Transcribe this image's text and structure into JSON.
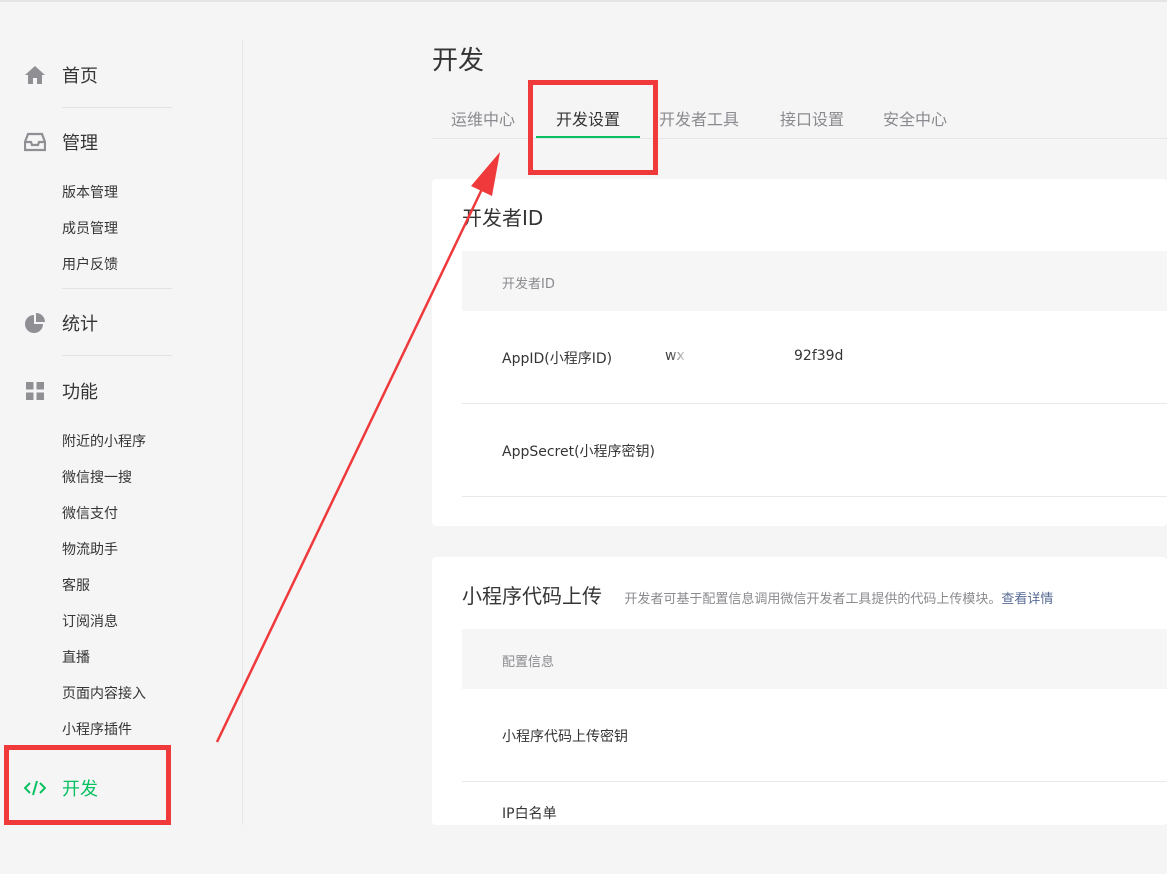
{
  "sidebar": {
    "home": {
      "label": "首页",
      "icon": "home-icon"
    },
    "manage": {
      "label": "管理",
      "icon": "inbox-icon",
      "items": [
        "版本管理",
        "成员管理",
        "用户反馈"
      ]
    },
    "stats": {
      "label": "统计",
      "icon": "pie-chart-icon"
    },
    "features": {
      "label": "功能",
      "icon": "grid-icon",
      "items": [
        "附近的小程序",
        "微信搜一搜",
        "微信支付",
        "物流助手",
        "客服",
        "订阅消息",
        "直播",
        "页面内容接入",
        "小程序插件"
      ]
    },
    "dev": {
      "label": "开发",
      "icon": "code-icon"
    }
  },
  "main": {
    "title": "开发",
    "tabs": [
      {
        "label": "运维中心"
      },
      {
        "label": "开发设置",
        "active": true
      },
      {
        "label": "开发者工具"
      },
      {
        "label": "接口设置"
      },
      {
        "label": "安全中心"
      }
    ],
    "dev_id_card": {
      "title": "开发者ID",
      "header": "开发者ID",
      "rows": [
        {
          "key": "AppID(小程序ID)",
          "value_prefix": "wx",
          "value_suffix": "92f39d"
        },
        {
          "key": "AppSecret(小程序密钥)"
        }
      ]
    },
    "upload_card": {
      "title": "小程序代码上传",
      "subtitle": "开发者可基于配置信息调用微信开发者工具提供的代码上传模块。",
      "link": "查看详情",
      "header": "配置信息",
      "rows": [
        {
          "key": "小程序代码上传密钥"
        },
        {
          "key": "IP白名单"
        }
      ]
    }
  },
  "colors": {
    "accent": "#07c160",
    "annotation": "#f0393b",
    "link": "#576b95"
  }
}
